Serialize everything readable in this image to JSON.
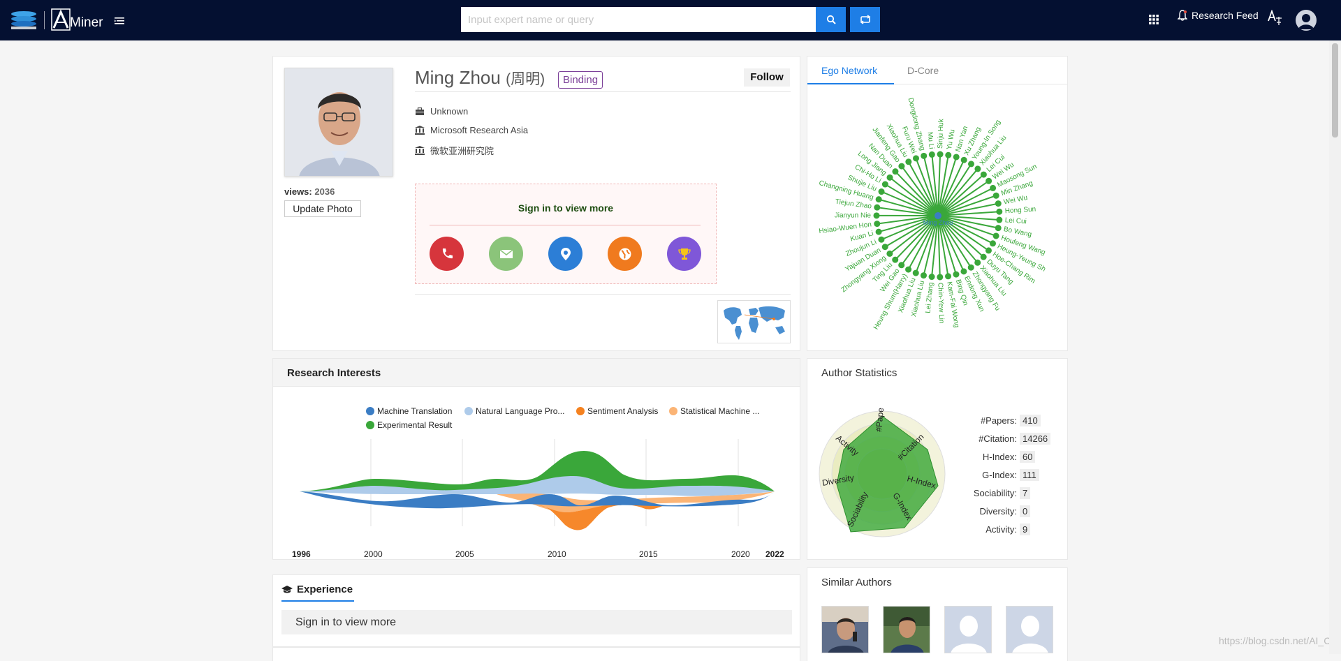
{
  "header": {
    "brand": "Miner",
    "search_placeholder": "Input expert name or query",
    "research_feed": "Research Feed"
  },
  "profile": {
    "name": "Ming Zhou",
    "name_cn": "(周明)",
    "binding": "Binding",
    "follow": "Follow",
    "views_label": "views:",
    "views_value": "2036",
    "update_photo": "Update Photo",
    "position": "Unknown",
    "affiliation": "Microsoft Research Asia",
    "affiliation_cn": "微软亚洲研究院",
    "signin_text": "Sign in to view more",
    "contact_colors": [
      "#d6353c",
      "#8bc47a",
      "#2c7ed6",
      "#f07a1e",
      "#7f57d8"
    ]
  },
  "ego_tabs": [
    "Ego Network",
    "D-Core"
  ],
  "ego_network": {
    "center": "Ming Zhou",
    "nodes": [
      "Sinju Huk",
      "Yu Wu",
      "Nan Yan",
      "Xu Zhang",
      "Young-In Song",
      "Xiaohua Liu",
      "Lei Cui",
      "Wei Wu",
      "Maosong Sun",
      "Min Zhang",
      "Wei Wu",
      "Hong Sun",
      "Lei Cui",
      "Bo Wang",
      "Houfeng Wang",
      "Heung-Yeung Sh",
      "Hoe-Chang Rim",
      "Duyu Tang",
      "Xiaohua Liu",
      "Zhongyang Fu",
      "Endong Xun",
      "Bing Qin",
      "Kam-Fai Wong",
      "Chin-Yew Lin",
      "Lei Zhang",
      "Xiaohua Liu",
      "Xiaohua Liu",
      "Heung Shum(Harry)",
      "Wei Gao",
      "Ting Liu",
      "Zhongyang Xiong",
      "Yajuan Duan",
      "Zhoujun Li",
      "Kuan Li",
      "Hsiao-Wuen Hon",
      "Jianyun Nie",
      "Tiejun Zhao",
      "Changning Huang",
      "Shujie Liu",
      "Chi-Ho Li",
      "Long Jiang",
      "Nan Duan",
      "Jianfeng Gao",
      "Xiaohua Liu",
      "Furu Wei",
      "Dongdong Zhang",
      "Mu Li"
    ]
  },
  "research_interests": {
    "title": "Research Interests",
    "legend": [
      "Machine Translation",
      "Natural Language Pro...",
      "Sentiment Analysis",
      "Statistical Machine ...",
      "Experimental Result"
    ]
  },
  "chart_data": {
    "type": "area",
    "title": "Research Interests",
    "x": [
      1996,
      2000,
      2005,
      2010,
      2011,
      2015,
      2020,
      2022
    ],
    "x_ticks": [
      "1996",
      "2000",
      "2005",
      "2010",
      "2015",
      "2020",
      "2022"
    ],
    "series": [
      {
        "name": "Machine Translation",
        "color": "#3b7dc4"
      },
      {
        "name": "Natural Language Pro...",
        "color": "#aecbea"
      },
      {
        "name": "Sentiment Analysis",
        "color": "#f58220"
      },
      {
        "name": "Statistical Machine ...",
        "color": "#fbb475"
      },
      {
        "name": "Experimental Result",
        "color": "#3aa73a"
      }
    ]
  },
  "author_stats": {
    "title": "Author Statistics",
    "axes": [
      "#Papers",
      "#Citation",
      "H-Index",
      "G-Index",
      "Sociability",
      "Diversity",
      "Activity"
    ],
    "rows": [
      {
        "label": "#Papers:",
        "value": "410"
      },
      {
        "label": "#Citation:",
        "value": "14266"
      },
      {
        "label": "H-Index:",
        "value": "60"
      },
      {
        "label": "G-Index:",
        "value": "111"
      },
      {
        "label": "Sociability:",
        "value": "7"
      },
      {
        "label": "Diversity:",
        "value": "0"
      },
      {
        "label": "Activity:",
        "value": "9"
      }
    ]
  },
  "experience": {
    "title": "Experience",
    "signin": "Sign in to view more"
  },
  "similar": {
    "title": "Similar Authors"
  },
  "watermark": "https://blog.csdn.net/AI_Conf"
}
